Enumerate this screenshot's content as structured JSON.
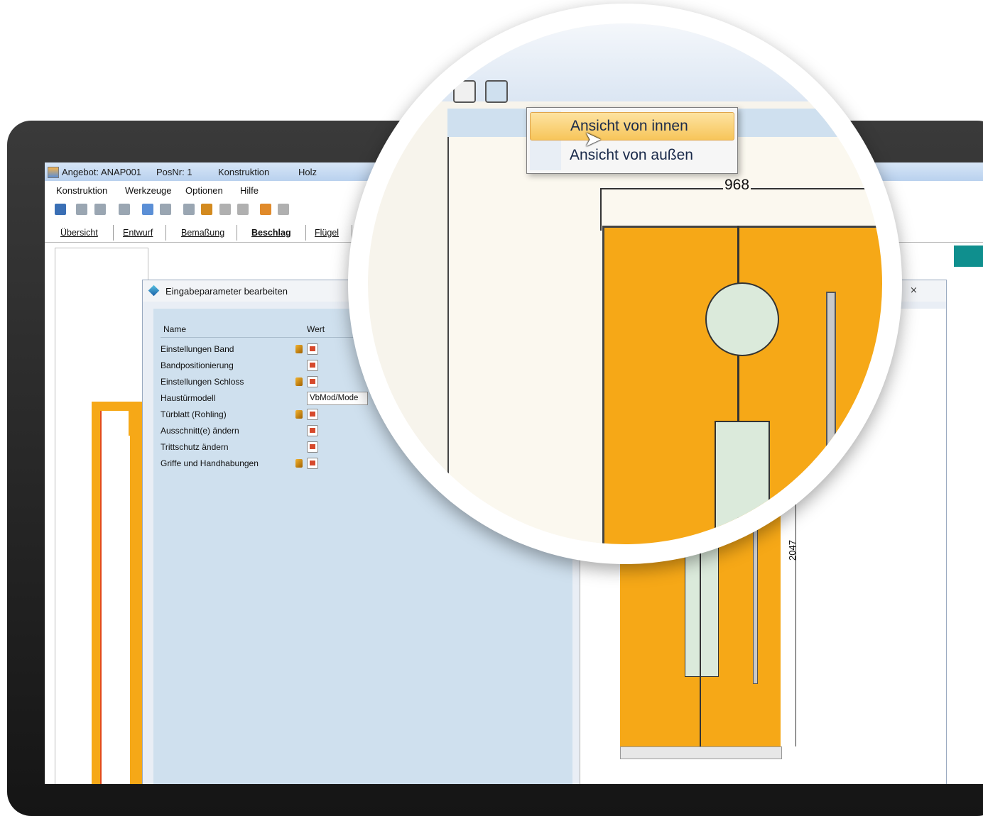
{
  "window": {
    "title_angebot": "Angebot: ANAP001",
    "title_posnr": "PosNr: 1",
    "title_mode": "Konstruktion",
    "title_material": "Holz"
  },
  "menu": [
    "Konstruktion",
    "Werkzeuge",
    "Optionen",
    "Hilfe"
  ],
  "tabs": [
    "Übersicht",
    "Entwurf",
    "Bemaßung",
    "Beschlag",
    "Flügel"
  ],
  "active_tab": "Beschlag",
  "dialog": {
    "title": "Eingabeparameter bearbeiten",
    "col_name": "Name",
    "col_wert": "Wert",
    "close": "⨯",
    "rows": [
      {
        "name": "Einstellungen Band"
      },
      {
        "name": "Bandpositionierung"
      },
      {
        "name": "Einstellungen Schloss"
      },
      {
        "name": "Haustürmodell",
        "value": "VbMod/Mode"
      },
      {
        "name": "Türblatt (Rohling)"
      },
      {
        "name": "Ausschnitt(e) ändern"
      },
      {
        "name": "Trittschutz ändern"
      },
      {
        "name": "Griffe und Handhabungen"
      }
    ]
  },
  "context_menu": {
    "items": [
      "Ansicht von innen",
      "Ansicht von außen"
    ],
    "highlighted": "Ansicht von innen"
  },
  "dimensions": {
    "width": "968",
    "height": "2047"
  },
  "colors": {
    "door": "#f6a817",
    "glass": "#dbeadb",
    "panel": "#cfe0ee",
    "highlight": "#f7c55a"
  }
}
